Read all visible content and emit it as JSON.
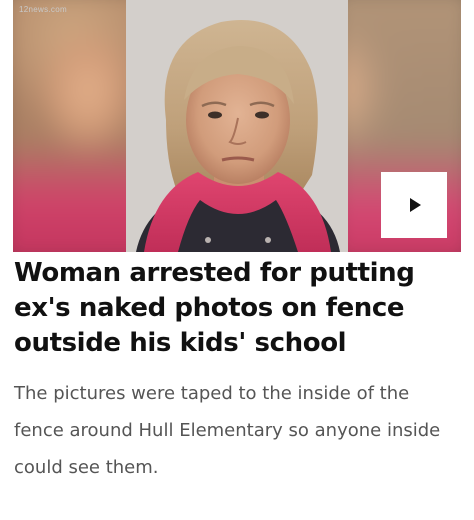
{
  "article": {
    "media": {
      "site_credit": "12news.com",
      "play_button_icon": "play-icon",
      "accent_color": "#d63b66"
    },
    "headline": "Woman arrested for putting ex's naked photos on fence outside his kids' school",
    "summary": "The pictures were taped to the inside of the fence around Hull Elementary so anyone inside could see them."
  }
}
